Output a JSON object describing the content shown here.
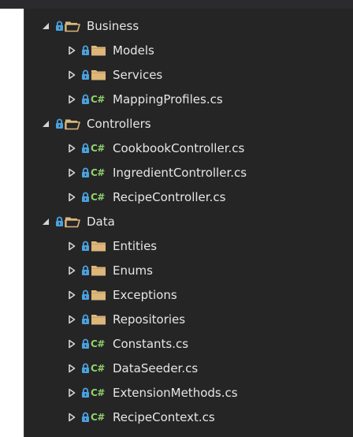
{
  "colors": {
    "background": "#252526",
    "text": "#e6e6e6",
    "folder": "#dcb67a",
    "lock": "#4aa3df",
    "csharp": "#8fd16a",
    "arrow": "#d4d4d4"
  },
  "tree": {
    "items": [
      {
        "label": "Business",
        "depth": 0,
        "expanded": true,
        "kind": "folder-open"
      },
      {
        "label": "Models",
        "depth": 1,
        "expanded": false,
        "kind": "folder"
      },
      {
        "label": "Services",
        "depth": 1,
        "expanded": false,
        "kind": "folder"
      },
      {
        "label": "MappingProfiles.cs",
        "depth": 1,
        "expanded": false,
        "kind": "csharp"
      },
      {
        "label": "Controllers",
        "depth": 0,
        "expanded": true,
        "kind": "folder-open"
      },
      {
        "label": "CookbookController.cs",
        "depth": 1,
        "expanded": false,
        "kind": "csharp"
      },
      {
        "label": "IngredientController.cs",
        "depth": 1,
        "expanded": false,
        "kind": "csharp"
      },
      {
        "label": "RecipeController.cs",
        "depth": 1,
        "expanded": false,
        "kind": "csharp"
      },
      {
        "label": "Data",
        "depth": 0,
        "expanded": true,
        "kind": "folder-open"
      },
      {
        "label": "Entities",
        "depth": 1,
        "expanded": false,
        "kind": "folder"
      },
      {
        "label": "Enums",
        "depth": 1,
        "expanded": false,
        "kind": "folder"
      },
      {
        "label": "Exceptions",
        "depth": 1,
        "expanded": false,
        "kind": "folder"
      },
      {
        "label": "Repositories",
        "depth": 1,
        "expanded": false,
        "kind": "folder"
      },
      {
        "label": "Constants.cs",
        "depth": 1,
        "expanded": false,
        "kind": "csharp"
      },
      {
        "label": "DataSeeder.cs",
        "depth": 1,
        "expanded": false,
        "kind": "csharp"
      },
      {
        "label": "ExtensionMethods.cs",
        "depth": 1,
        "expanded": false,
        "kind": "csharp"
      },
      {
        "label": "RecipeContext.cs",
        "depth": 1,
        "expanded": false,
        "kind": "csharp"
      }
    ],
    "csharp_badge": "C#"
  }
}
